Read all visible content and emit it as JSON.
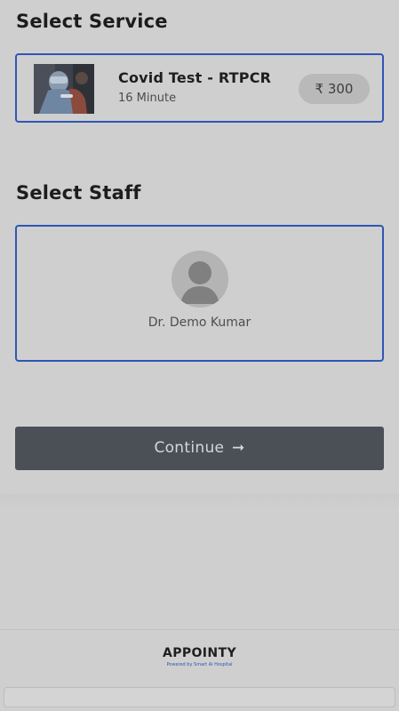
{
  "service_section": {
    "title": "Select Service",
    "service": {
      "name": "Covid Test - RTPCR",
      "duration": "16 Minute",
      "price": "₹ 300"
    }
  },
  "staff_section": {
    "title": "Select Staff",
    "staff": {
      "name": "Dr. Demo Kumar"
    }
  },
  "actions": {
    "continue_label": "Continue",
    "continue_arrow": "➞"
  },
  "footer": {
    "brand": "APPOINTY",
    "powered_by": "Powered by Smart Ai Hospital"
  },
  "colors": {
    "accent_border": "#2f56b5",
    "button_bg": "#4b5057",
    "overlay_bg": "#cfcfcf"
  }
}
